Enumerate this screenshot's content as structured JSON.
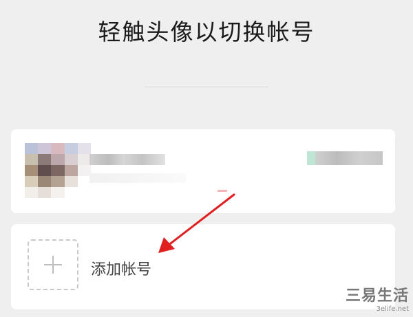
{
  "title": "轻触头像以切换帐号",
  "add_account": {
    "label": "添加帐号",
    "icon": "plus-icon"
  },
  "watermark": {
    "text": "三易生活",
    "site": "3elife.net"
  },
  "colors": {
    "background": "#efefef",
    "card": "#ffffff",
    "annotation_arrow": "#e02020"
  }
}
